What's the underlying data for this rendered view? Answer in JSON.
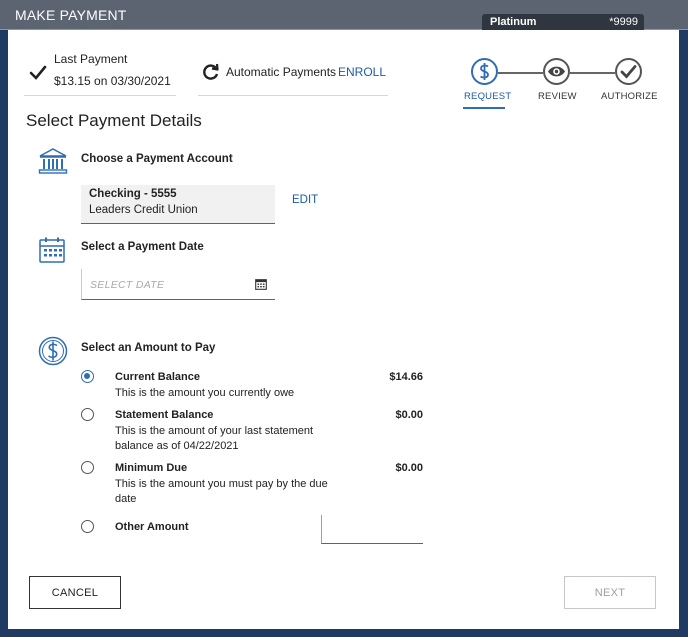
{
  "window": {
    "title": "MAKE PAYMENT"
  },
  "card": {
    "name": "Platinum",
    "number": "*9999"
  },
  "last_payment": {
    "label": "Last Payment",
    "value": "$13.15 on 03/30/2021"
  },
  "automatic_payments": {
    "label": "Automatic Payments",
    "enroll_label": "ENROLL"
  },
  "steps": [
    {
      "label": "REQUEST",
      "active": true
    },
    {
      "label": "REVIEW",
      "active": false
    },
    {
      "label": "AUTHORIZE",
      "active": false
    }
  ],
  "heading": "Select Payment Details",
  "account_section": {
    "title": "Choose a Payment Account",
    "account_name": "Checking - 5555",
    "bank": "Leaders Credit Union",
    "edit_label": "EDIT"
  },
  "date_section": {
    "title": "Select a Payment Date",
    "placeholder": "SELECT DATE"
  },
  "amount_section": {
    "title": "Select an Amount to Pay",
    "options": [
      {
        "title": "Current Balance",
        "description": "This is the amount you currently owe",
        "amount": "$14.66",
        "selected": true
      },
      {
        "title": "Statement Balance",
        "description": "This is the amount of your last statement balance as of 04/22/2021",
        "amount": "$0.00",
        "selected": false
      },
      {
        "title": "Minimum Due",
        "description": "This is the amount you must pay by the due date",
        "amount": "$0.00",
        "selected": false
      },
      {
        "title": "Other Amount",
        "description": "",
        "amount": "",
        "selected": false
      }
    ]
  },
  "buttons": {
    "cancel": "CANCEL",
    "next": "NEXT"
  },
  "colors": {
    "accent": "#2f6db5",
    "link": "#1d5ba6",
    "titlebar": "#5b6470",
    "backdrop": "#1f3b63"
  }
}
